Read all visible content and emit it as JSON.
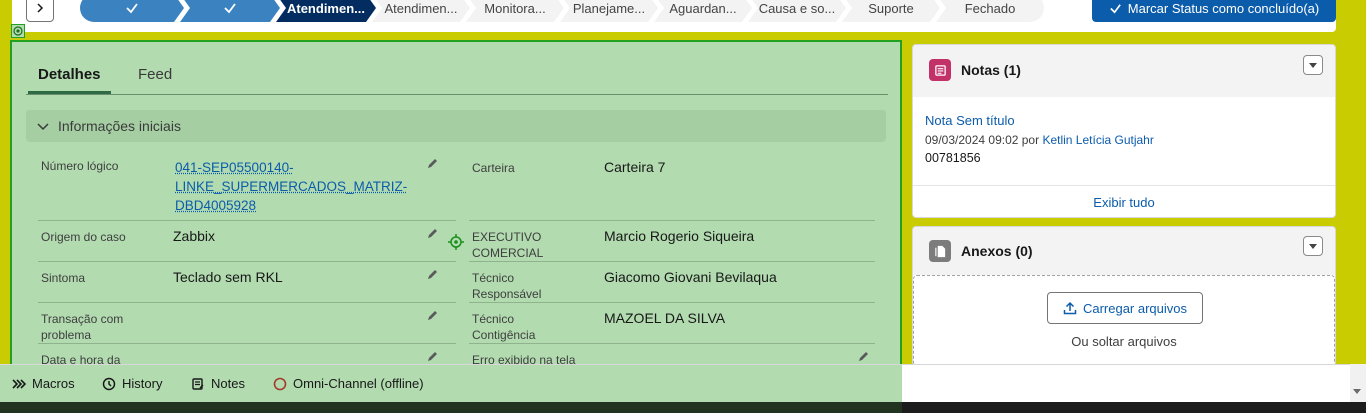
{
  "path": {
    "stages": [
      {
        "label": "",
        "state": "done",
        "icon": "check-icon"
      },
      {
        "label": "",
        "state": "done",
        "icon": "check-icon"
      },
      {
        "label": "Atendimen...",
        "state": "current"
      },
      {
        "label": "Atendimen...",
        "state": "todo"
      },
      {
        "label": "Monitora...",
        "state": "todo"
      },
      {
        "label": "Planejame...",
        "state": "todo"
      },
      {
        "label": "Aguardan...",
        "state": "todo"
      },
      {
        "label": "Causa e so...",
        "state": "todo"
      },
      {
        "label": "Suporte",
        "state": "todo"
      },
      {
        "label": "Fechado",
        "state": "todo"
      }
    ],
    "mark_button": "Marcar Status como concluído(a)"
  },
  "tabs": {
    "details": "Detalhes",
    "feed": "Feed"
  },
  "section": {
    "title": "Informações iniciais"
  },
  "fields": {
    "numero_logico": {
      "label": "Número lógico",
      "value": "041-SEP05500140-LINKE_SUPERMERCADOS_MATRIZ-DBD4005928",
      "line1": "041-SEP05500140-",
      "line2": "LINKE_SUPERMERCADOS_MATRIZ-",
      "line3": "DBD4005928"
    },
    "carteira": {
      "label": "Carteira",
      "value": "Carteira 7"
    },
    "origem": {
      "label": "Origem do caso",
      "value": "Zabbix"
    },
    "executivo": {
      "label1": "EXECUTIVO",
      "label2": "COMERCIAL",
      "value": "Marcio Rogerio Siqueira"
    },
    "sintoma": {
      "label": "Sintoma",
      "value": "Teclado sem RKL"
    },
    "tecnico_resp": {
      "label1": "Técnico",
      "label2": "Responsável",
      "value": "Giacomo Giovani Bevilaqua"
    },
    "transacao": {
      "label1": "Transação com",
      "label2": "problema",
      "value": ""
    },
    "tecnico_cont": {
      "label1": "Técnico",
      "label2": "Contigência",
      "value": "MAZOEL DA SILVA"
    },
    "data_hora": {
      "label": "Data e hora da",
      "value": ""
    },
    "erro": {
      "label": "Erro exibido na tela",
      "value": ""
    }
  },
  "notes_card": {
    "title": "Notas (1)",
    "note_title": "Nota Sem título",
    "note_date": "09/03/2024 09:02 por",
    "note_author": "Ketlin Letícia Gutjahr",
    "note_number": "00781856",
    "footer": "Exibir tudo",
    "icon_color": "#c23268"
  },
  "attachments_card": {
    "title": "Anexos (0)",
    "upload_button": "Carregar arquivos",
    "drop_text": "Ou soltar arquivos",
    "icon_color": "#7c7c7c"
  },
  "utility": {
    "macros": "Macros",
    "history": "History",
    "notes": "Notes",
    "omni": "Omni-Channel (offline)"
  },
  "colors": {
    "accent": "#0b5cab",
    "path_done": "#3b83c0",
    "path_current": "#032d60",
    "overlay_green": "#b2dbb0",
    "page_background": "#c9cc00"
  }
}
